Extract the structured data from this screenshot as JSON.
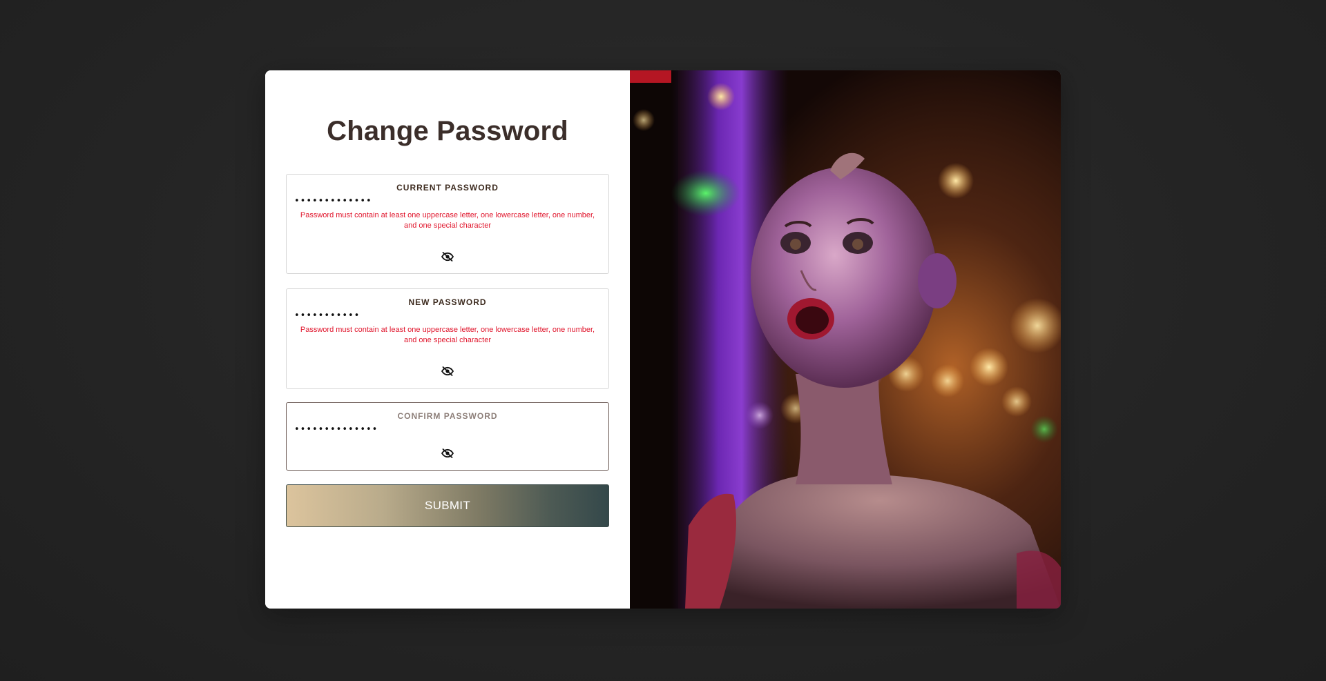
{
  "form": {
    "title": "Change Password",
    "submit_label": "SUBMIT",
    "fields": [
      {
        "label": "CURRENT PASSWORD",
        "value": "•••••••••••••",
        "error": "Password must contain at least one uppercase letter, one lowercase letter, one number, and one special character",
        "toggle_icon": "eye-off-icon"
      },
      {
        "label": "NEW PASSWORD",
        "value": "•••••••••••",
        "error": "Password must contain at least one uppercase letter, one lowercase letter, one number, and one special character",
        "toggle_icon": "eye-off-icon"
      },
      {
        "label": "CONFIRM PASSWORD",
        "value": "••••••••••••••",
        "toggle_icon": "eye-off-icon"
      }
    ]
  },
  "colors": {
    "background": "#262626",
    "title": "#3b2e2a",
    "error": "#e0142b",
    "submit_gradient_start": "#dcc49d",
    "submit_gradient_end": "#34484a"
  },
  "image": {
    "description_icon": "mannequin-photo"
  }
}
